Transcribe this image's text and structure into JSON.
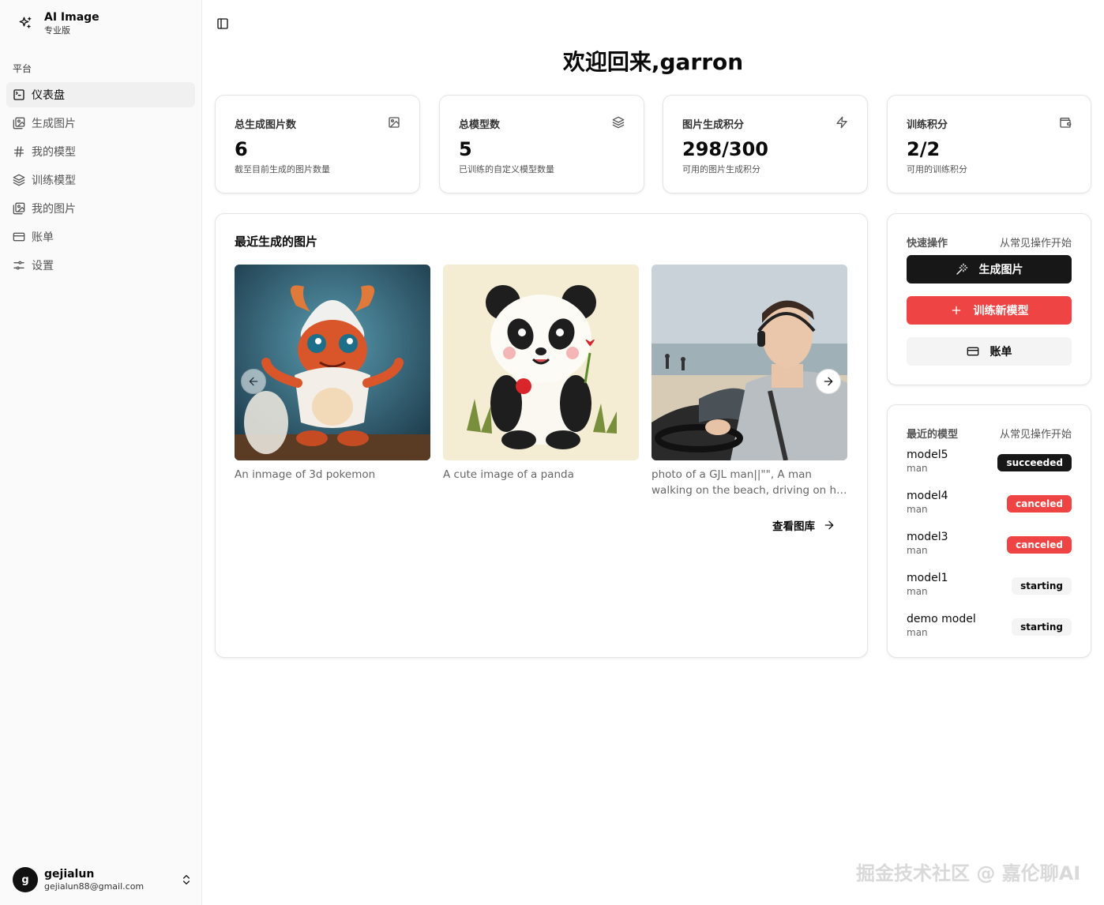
{
  "sidebar": {
    "brand_name": "AI Image",
    "brand_sub": "专业版",
    "group_label": "平台",
    "items": [
      {
        "label": "仪表盘",
        "icon": "terminal-square-icon",
        "active": true
      },
      {
        "label": "生成图片",
        "icon": "images-icon",
        "active": false
      },
      {
        "label": "我的模型",
        "icon": "hash-icon",
        "active": false
      },
      {
        "label": "训练模型",
        "icon": "layers-icon",
        "active": false
      },
      {
        "label": "我的图片",
        "icon": "images-icon",
        "active": false
      },
      {
        "label": "账单",
        "icon": "credit-card-icon",
        "active": false
      },
      {
        "label": "设置",
        "icon": "sliders-icon",
        "active": false
      }
    ],
    "user": {
      "initial": "g",
      "name": "gejialun",
      "email": "gejialun88@gmail.com"
    }
  },
  "main": {
    "title": "欢迎回来,garron",
    "stats": [
      {
        "title": "总生成图片数",
        "value": "6",
        "desc": "截至目前生成的图片数量",
        "icon": "image-icon"
      },
      {
        "title": "总模型数",
        "value": "5",
        "desc": "已训练的自定义模型数量",
        "icon": "layers-icon"
      },
      {
        "title": "图片生成积分",
        "value": "298/300",
        "desc": "可用的图片生成积分",
        "icon": "zap-icon"
      },
      {
        "title": "训练积分",
        "value": "2/2",
        "desc": "可用的训练积分",
        "icon": "wallet-icon"
      }
    ],
    "recent": {
      "title": "最近生成的图片",
      "images": [
        {
          "caption": "An inmage of 3d pokemon"
        },
        {
          "caption": "A cute image of a panda"
        },
        {
          "caption": "photo of a GJL man||\"\", A man walking on the beach, driving on his car"
        }
      ],
      "gallery_link": "查看图库"
    },
    "quick": {
      "title": "快速操作",
      "subtitle": "从常见操作开始",
      "buttons": {
        "generate": "生成图片",
        "train": "训练新模型",
        "billing": "账单"
      }
    },
    "models": {
      "title": "最近的模型",
      "subtitle": "从常见操作开始",
      "rows": [
        {
          "name": "model5",
          "sub": "man",
          "status": "succeeded"
        },
        {
          "name": "model4",
          "sub": "man",
          "status": "canceled"
        },
        {
          "name": "model3",
          "sub": "man",
          "status": "canceled"
        },
        {
          "name": "model1",
          "sub": "man",
          "status": "starting"
        },
        {
          "name": "demo model",
          "sub": "man",
          "status": "starting"
        }
      ]
    }
  },
  "watermark": "掘金技术社区 @ 嘉伦聊AI",
  "colors": {
    "accent_red": "#ef4444",
    "dark": "#171717",
    "muted": "#f4f4f5"
  }
}
